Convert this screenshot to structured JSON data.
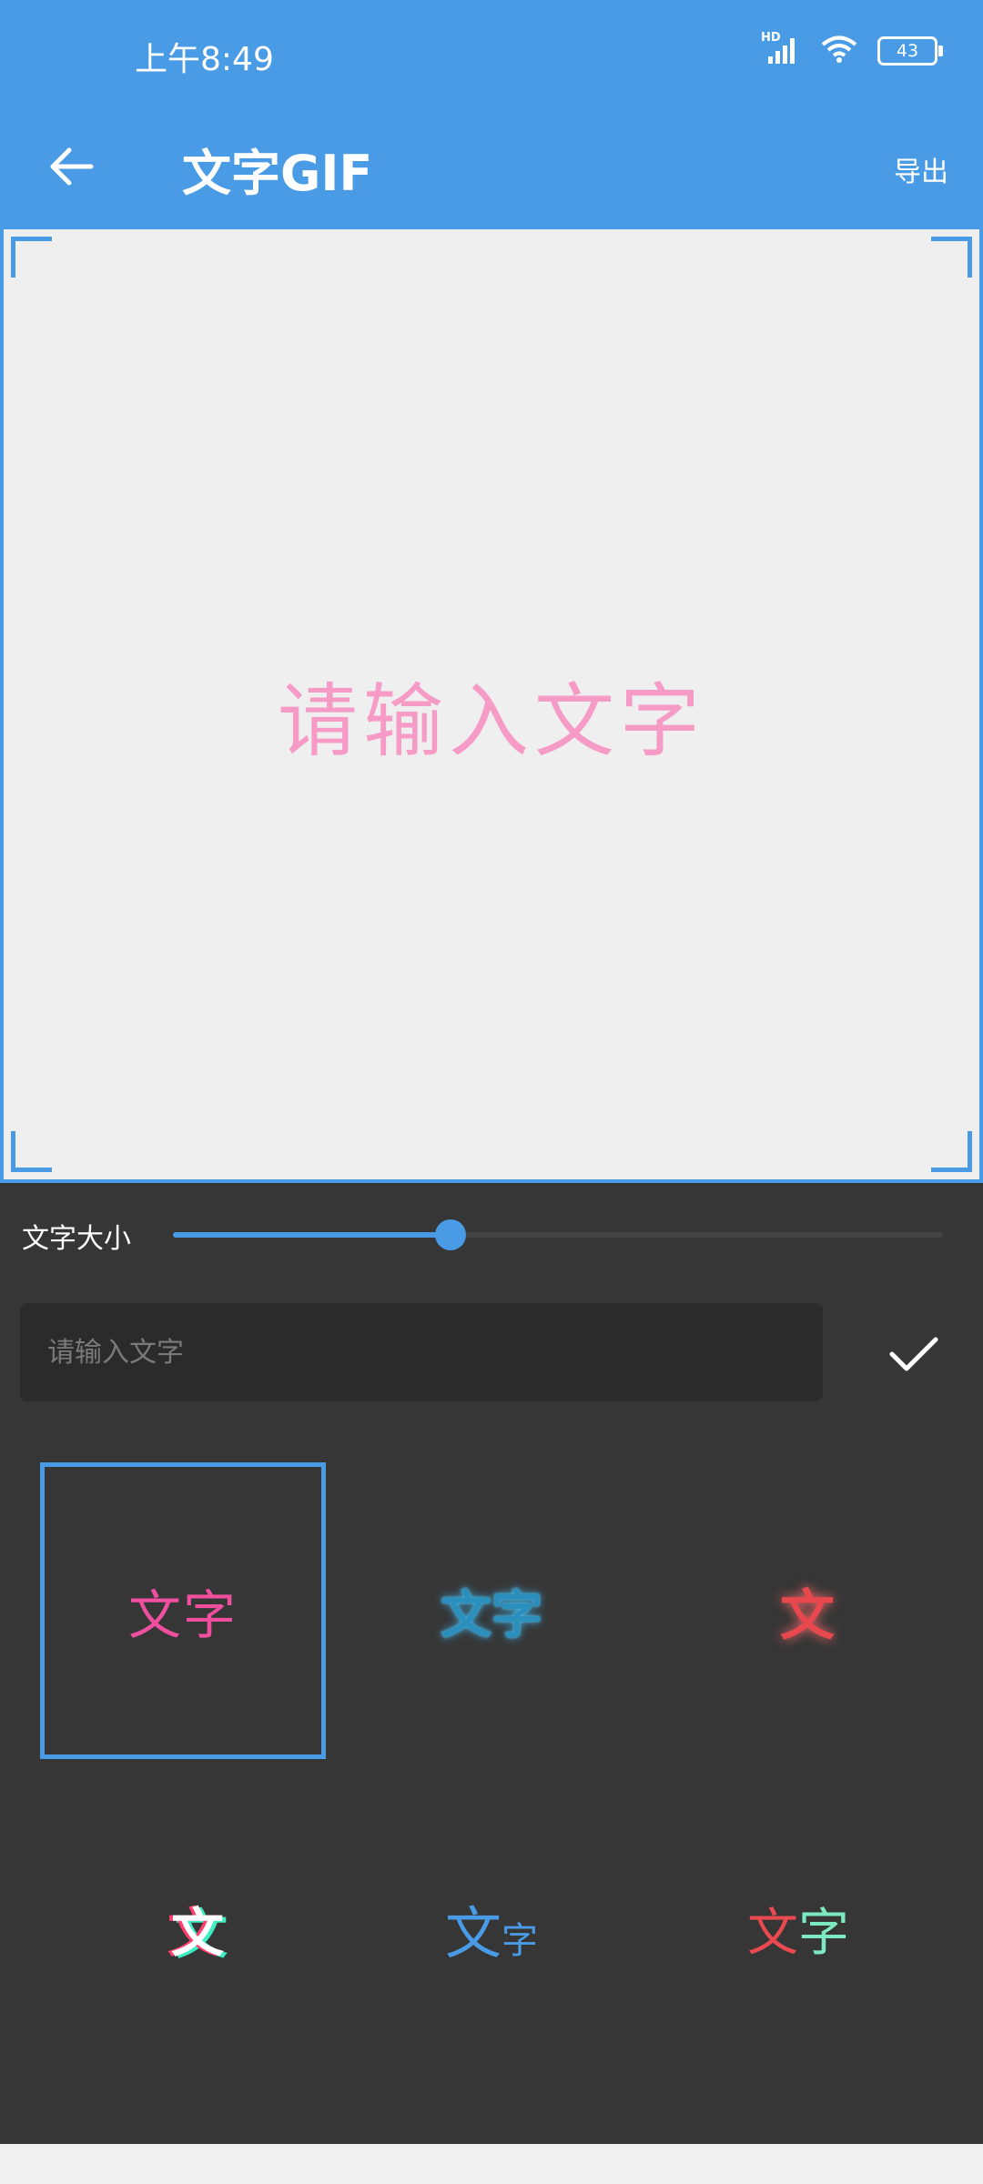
{
  "status_bar": {
    "time": "上午8:49",
    "network": "HD",
    "battery": "43"
  },
  "app_bar": {
    "title": "文字GIF",
    "export_label": "导出"
  },
  "canvas": {
    "preview_text": "请输入文字",
    "preview_color": "#f59bc6"
  },
  "controls": {
    "size_label": "文字大小",
    "size_value": 0.36,
    "input_placeholder": "请输入文字",
    "input_value": ""
  },
  "styles": [
    {
      "label": "文字",
      "selected": true
    },
    {
      "label": "文字",
      "selected": false
    },
    {
      "label": "文",
      "selected": false
    },
    {
      "label": "文",
      "selected": false
    },
    {
      "label_big": "文",
      "label_small": "字",
      "selected": false
    },
    {
      "label_a": "文",
      "label_b": "字",
      "selected": false
    }
  ],
  "colors": {
    "accent": "#4a9be6",
    "panel": "#363636",
    "canvas": "#efefef"
  }
}
